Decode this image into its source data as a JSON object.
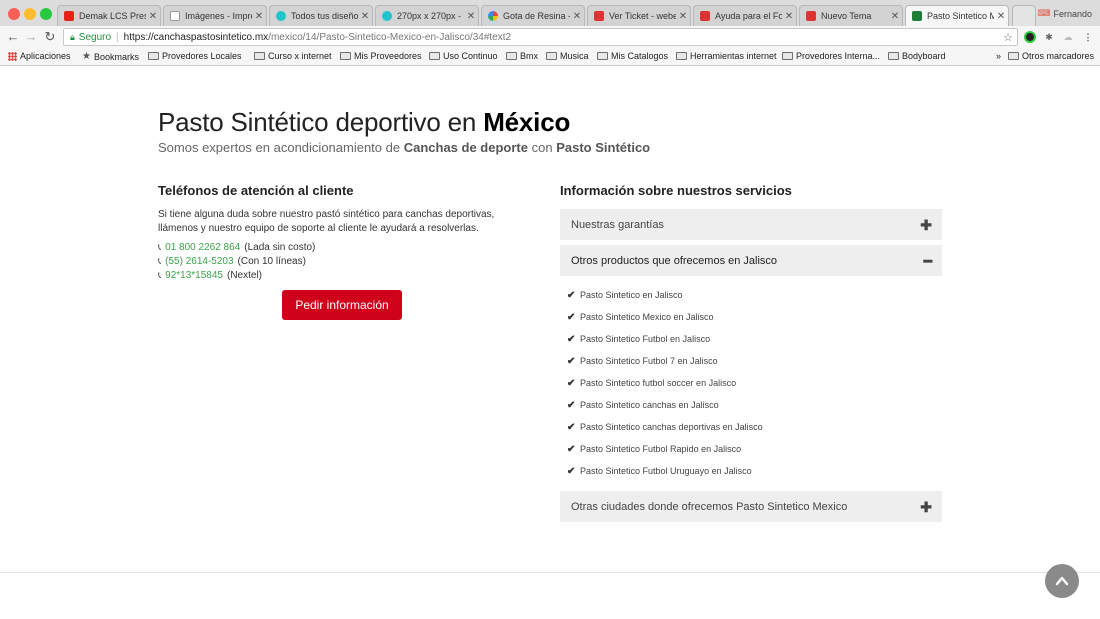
{
  "browser": {
    "tabs": [
      {
        "label": "Demak LCS Prese",
        "color": "#e62117"
      },
      {
        "label": "Imágenes - Impre",
        "color": "#8a8a8a"
      },
      {
        "label": "Todos tus diseño",
        "color": "#20c4cb"
      },
      {
        "label": "270px x 270px -",
        "color": "#20c4cb"
      },
      {
        "label": "Gota de Resina -",
        "color": "#f4b400"
      },
      {
        "label": "Ver Ticket - webe",
        "color": "#d33"
      },
      {
        "label": "Ayuda para el For",
        "color": "#d33"
      },
      {
        "label": "Nuevo Tema",
        "color": "#d33"
      },
      {
        "label": "Pasto Sintetico M",
        "color": "#1d7f35"
      }
    ],
    "profile_name": "Fernando",
    "url_secure_label": "Seguro",
    "url_host": "https://canchaspastosintetico.mx",
    "url_path": "/mexico/14/Pasto-Sintetico-Mexico-en-Jalisco/34#text2",
    "bookmarks": [
      {
        "label": "Aplicaciones",
        "icon": "apps-icon"
      },
      {
        "label": "Bookmarks",
        "icon": "star-icon"
      },
      {
        "label": "Provedores Locales",
        "icon": "folder-icon"
      },
      {
        "label": "Curso x internet",
        "icon": "folder-icon"
      },
      {
        "label": "Mis Proveedores",
        "icon": "folder-icon"
      },
      {
        "label": "Uso Continuo",
        "icon": "folder-icon"
      },
      {
        "label": "Bmx",
        "icon": "folder-icon"
      },
      {
        "label": "Musica",
        "icon": "folder-icon"
      },
      {
        "label": "Mis Catalogos",
        "icon": "folder-icon"
      },
      {
        "label": "Herramientas internet",
        "icon": "folder-icon"
      },
      {
        "label": "Provedores Interna...",
        "icon": "folder-icon"
      },
      {
        "label": "Bodyboard",
        "icon": "folder-icon"
      }
    ],
    "overflow_label": "»",
    "other_bookmarks": "Otros marcadores"
  },
  "page": {
    "title_light": "Pasto Sintético deportivo en",
    "title_bold": "México",
    "subtitle_a": "Somos expertos en acondicionamiento de",
    "subtitle_b": "Canchas de deporte",
    "subtitle_c": "con",
    "subtitle_d": "Pasto Sintético",
    "contact": {
      "heading": "Teléfonos de atención al cliente",
      "line1": "Si tiene alguna duda sobre nuestro pastó sintético para canchas deportivas,",
      "line2": "llámenos y nuestro equipo de soporte al cliente le ayudará a resolverlas.",
      "phones": [
        {
          "number": "01 800 2262 864",
          "note": "(Lada sin costo)"
        },
        {
          "number": "(55) 2614-5203",
          "note": "(Con 10 líneas)"
        },
        {
          "number": "92*13*15845",
          "note": "(Nextel)"
        }
      ],
      "cta_label": "Pedir información"
    },
    "services": {
      "heading": "Información sobre nuestros servicios",
      "accordion": [
        {
          "label": "Nuestras garantías",
          "toggle": "✚",
          "open": false
        },
        {
          "label": "Otros productos que ofrecemos en Jalisco",
          "toggle": "━",
          "open": true
        },
        {
          "label": "Otras ciudades donde ofrecemos Pasto Sintetico Mexico",
          "toggle": "✚",
          "open": false
        }
      ],
      "products": [
        "Pasto Sintetico en Jalisco",
        "Pasto Sintetico Mexico en Jalisco",
        "Pasto Sintetico Futbol en Jalisco",
        "Pasto Sintetico Futbol 7 en Jalisco",
        "Pasto Sintetico futbol soccer en Jalisco",
        "Pasto Sintetico canchas en Jalisco",
        "Pasto Sintetico canchas deportivas en Jalisco",
        "Pasto Sintetico Futbol Rapido en Jalisco",
        "Pasto Sintetico Futbol Uruguayo en Jalisco"
      ]
    }
  }
}
